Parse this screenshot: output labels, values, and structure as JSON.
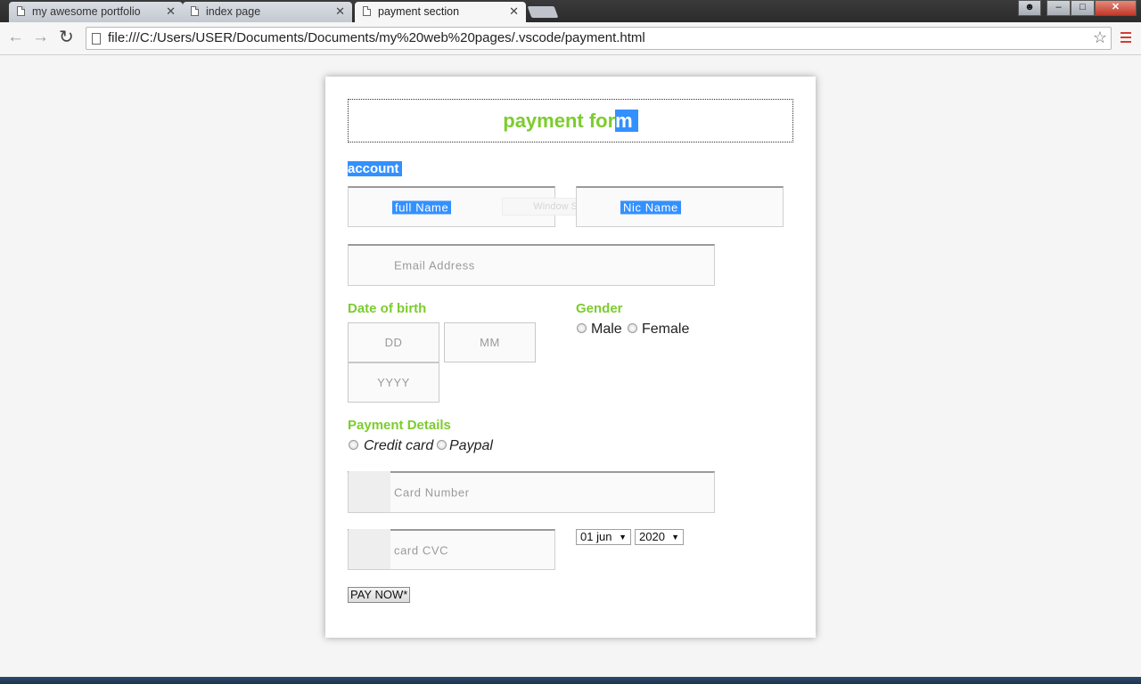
{
  "browser": {
    "tabs": [
      {
        "label": "my awesome portfolio",
        "active": false
      },
      {
        "label": "index page",
        "active": false
      },
      {
        "label": "payment section",
        "active": true
      }
    ],
    "close_glyph": "✕",
    "url": "file:///C:/Users/USER/Documents/Documents/my%20web%20pages/.vscode/payment.html",
    "icons": [
      "back-arrow-icon",
      "forward-arrow-icon",
      "reload-icon",
      "page-icon",
      "bookmark-star-icon",
      "menu-icon"
    ]
  },
  "form": {
    "title_main": "payment for",
    "title_selected": "m",
    "account_label": "account",
    "full_name_placeholder": "full Name",
    "nic_name_placeholder": "Nic Name",
    "ghost_text": "Window Snip",
    "email_placeholder": "Email Address",
    "dob_label": "Date of birth",
    "dd_placeholder": "DD",
    "mm_placeholder": "MM",
    "yyyy_placeholder": "YYYY",
    "gender_label": "Gender",
    "gender_options": [
      "Male",
      "Female"
    ],
    "payment_label": "Payment Details",
    "payment_options": [
      "Credit card",
      "Paypal"
    ],
    "card_number_placeholder": "Card Number",
    "card_cvc_placeholder": "card CVC",
    "expiry_day": "01 jun",
    "expiry_year": "2020",
    "pay_button": "PAY NOW*"
  },
  "colors": {
    "accent_green": "#7dcc2e",
    "selection_blue": "#3390ff"
  }
}
